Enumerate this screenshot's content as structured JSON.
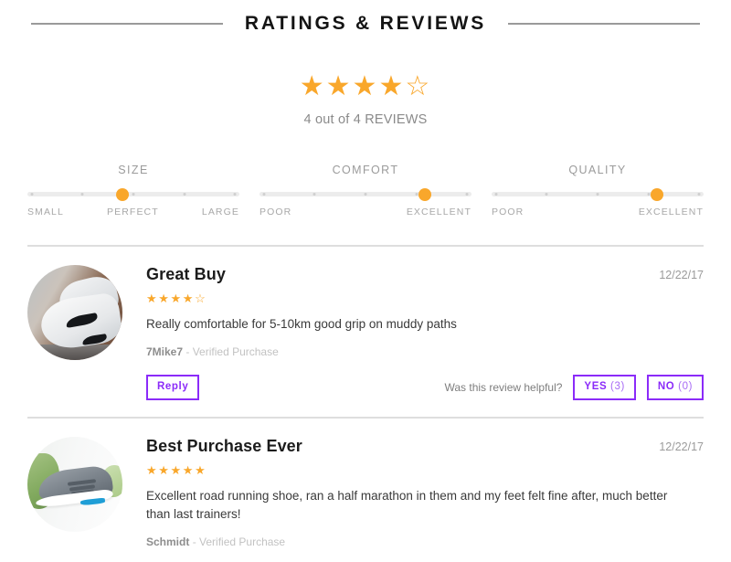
{
  "section": {
    "title": "RATINGS & REVIEWS"
  },
  "summary": {
    "stars_filled": 4,
    "stars_total": 5,
    "count_text": "4 out of 4 REVIEWS",
    "star_glyph_filled": "★",
    "star_glyph_empty": "☆"
  },
  "colors": {
    "star": "#f9a72b",
    "accent_purple": "#8b2bf9",
    "track": "#ececec",
    "divider": "#dedede"
  },
  "attributes": [
    {
      "name": "SIZE",
      "position_pct": 45,
      "scale_left": "SMALL",
      "scale_mid": "PERFECT",
      "scale_right": "LARGE"
    },
    {
      "name": "COMFORT",
      "position_pct": 78,
      "scale_left": "POOR",
      "scale_mid": "",
      "scale_right": "EXCELLENT"
    },
    {
      "name": "QUALITY",
      "position_pct": 78,
      "scale_left": "POOR",
      "scale_mid": "",
      "scale_right": "EXCELLENT"
    }
  ],
  "reviews": [
    {
      "title": "Great Buy",
      "date": "12/22/17",
      "stars_filled": 4,
      "text": "Really comfortable for 5-10km good grip on muddy paths",
      "author": "7Mike7",
      "separator": "-",
      "verified": "Verified Purchase",
      "reply_label": "Reply",
      "helpful_label": "Was this review helpful?",
      "yes_label": "YES",
      "yes_count": "(3)",
      "no_label": "NO",
      "no_count": "(0)",
      "avatar_name": "white-nike-sneakers-photo"
    },
    {
      "title": "Best Purchase Ever",
      "date": "12/22/17",
      "stars_filled": 5,
      "text": "Excellent road running shoe, ran a half marathon in them and my feet felt fine after, much better than last trainers!",
      "author": "Schmidt",
      "separator": "-",
      "verified": "Verified Purchase",
      "avatar_name": "grey-adidas-running-shoe-photo"
    }
  ]
}
